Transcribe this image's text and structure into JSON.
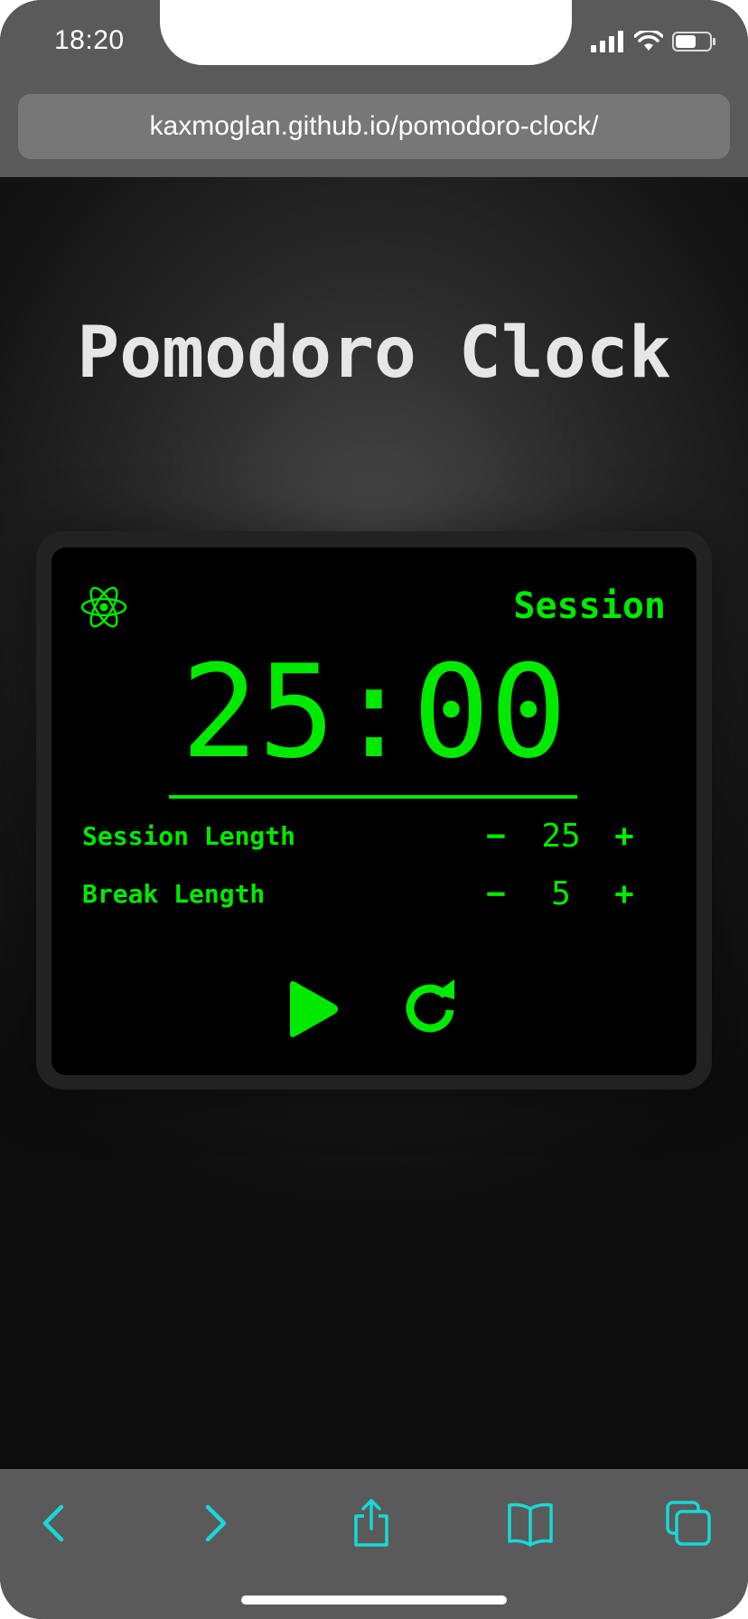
{
  "status_bar": {
    "time": "18:20"
  },
  "browser": {
    "url": "kaxmoglan.github.io/pomodoro-clock/"
  },
  "page": {
    "title": "Pomodoro Clock"
  },
  "clock": {
    "mode": "Session",
    "time_display": "25:00",
    "session_length_label": "Session Length",
    "session_length_value": "25",
    "break_length_label": "Break Length",
    "break_length_value": "5",
    "decrement_symbol": "−",
    "increment_symbol": "+"
  },
  "colors": {
    "accent_green": "#00ea00",
    "toolbar_cyan": "#19d8d8",
    "chrome_gray": "#5a5a5a"
  },
  "icons": {
    "logo": "react-atom-icon",
    "play": "play-icon",
    "reset": "refresh-icon",
    "toolbar": [
      "back-chevron-icon",
      "forward-chevron-icon",
      "share-icon",
      "bookmarks-book-icon",
      "tabs-icon"
    ]
  }
}
